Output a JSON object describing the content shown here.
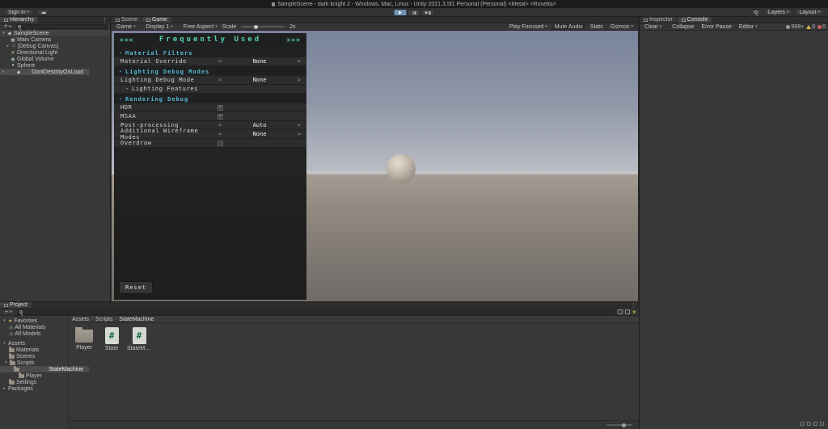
{
  "ui": {
    "caret_down": "▾",
    "fold_open": "▾",
    "fold_closed": "▸",
    "plus": "+",
    "overflow": "⋮",
    "selector_prev": "<",
    "selector_next": ">",
    "breadcrumb_sep": "›",
    "hash": "#",
    "play_glyph": "▶"
  },
  "icons": {
    "scene": "◆",
    "camera": "▣",
    "canvas": "□",
    "light": "☀",
    "volume": "◉",
    "sphere": "●",
    "star": "★",
    "lens": "◎",
    "cloud": "☁"
  },
  "colors": {
    "overlay_title_accent": "#53d3b2",
    "overlay_section_accent": "#54b9d1",
    "selection_gray": "#4c4c4c",
    "play_button_active": "#6f93b4",
    "warning_yellow": "#d8b44a",
    "error_red": "#cf5f5f"
  },
  "titlebar": {
    "title": "SampleScene - dark knight 2 - Windows, Mac, Linux - Unity 2021.3.5f1 Personal (Personal) <Metal> <Rosetta>"
  },
  "toolbar": {
    "sign_in": "Sign In",
    "layers": "Layers",
    "layout": "Layout"
  },
  "hierarchy": {
    "tab_label": "Hierarchy",
    "scene1": "SampleScene",
    "items": [
      "Main Camera",
      "[Debug Canvas]",
      "Directional Light",
      "Global Volume",
      "Sphere"
    ],
    "scene2": "DontDestroyOnLoad"
  },
  "game_view": {
    "scene_tab": "Scene",
    "game_tab": "Game",
    "toolbar": {
      "mode": "Game",
      "display": "Display 1",
      "aspect": "Free Aspect",
      "scale_label": "Scale",
      "scale_value": "2x",
      "play_focused": "Play Focused",
      "mute_audio": "Mute Audio",
      "stats": "Stats",
      "gizmos": "Gizmos"
    }
  },
  "debug_overlay": {
    "prev": "<<<",
    "title": "Frequently Used",
    "next": ">>>",
    "sections": {
      "material_filters": "Material Filters",
      "lighting": "Lighting Debug Modes",
      "rendering": "Rendering Debug"
    },
    "rows": {
      "material_override": {
        "label": "Material Override",
        "value": "None"
      },
      "lighting_debug_mode": {
        "label": "Lighting Debug Mode",
        "value": "None"
      },
      "lighting_features": {
        "label": "Lighting Features"
      },
      "hdr": {
        "label": "HDR",
        "checked": true,
        "check_glyph": "✓"
      },
      "msaa": {
        "label": "MSAA",
        "checked": true,
        "check_glyph": "✓"
      },
      "post_processing": {
        "label": "Post-processing",
        "value": "Auto"
      },
      "additional_wireframe": {
        "label": "Additional Wireframe Modes",
        "value": "None"
      },
      "overdraw": {
        "label": "Overdraw",
        "checked": false,
        "check_glyph": ""
      }
    },
    "reset_label": "Reset"
  },
  "console_panel": {
    "inspector_tab": "Inspector",
    "console_tab": "Console",
    "clear_label": "Clear",
    "collapse_label": "Collapse",
    "error_pause_label": "Error Pause",
    "editor_label": "Editor",
    "info_count": "999+",
    "warning_count": "0",
    "error_count": "0"
  },
  "project": {
    "tab_label": "Project",
    "breadcrumb": [
      "Assets",
      "Scripts",
      "StateMachine"
    ],
    "tree": {
      "favorites": "Favorites",
      "all_materials": "All Materials",
      "all_models": "All Models",
      "assets": "Assets",
      "materials": "Materials",
      "scenes": "Scenes",
      "scripts": "Scripts",
      "statemachine": "StateMachine",
      "player": "Player",
      "settings": "Settings",
      "packages": "Packages"
    },
    "grid": [
      {
        "label": "Player",
        "type": "folder"
      },
      {
        "label": "State",
        "type": "script"
      },
      {
        "label": "StateMach...",
        "type": "script"
      }
    ]
  }
}
